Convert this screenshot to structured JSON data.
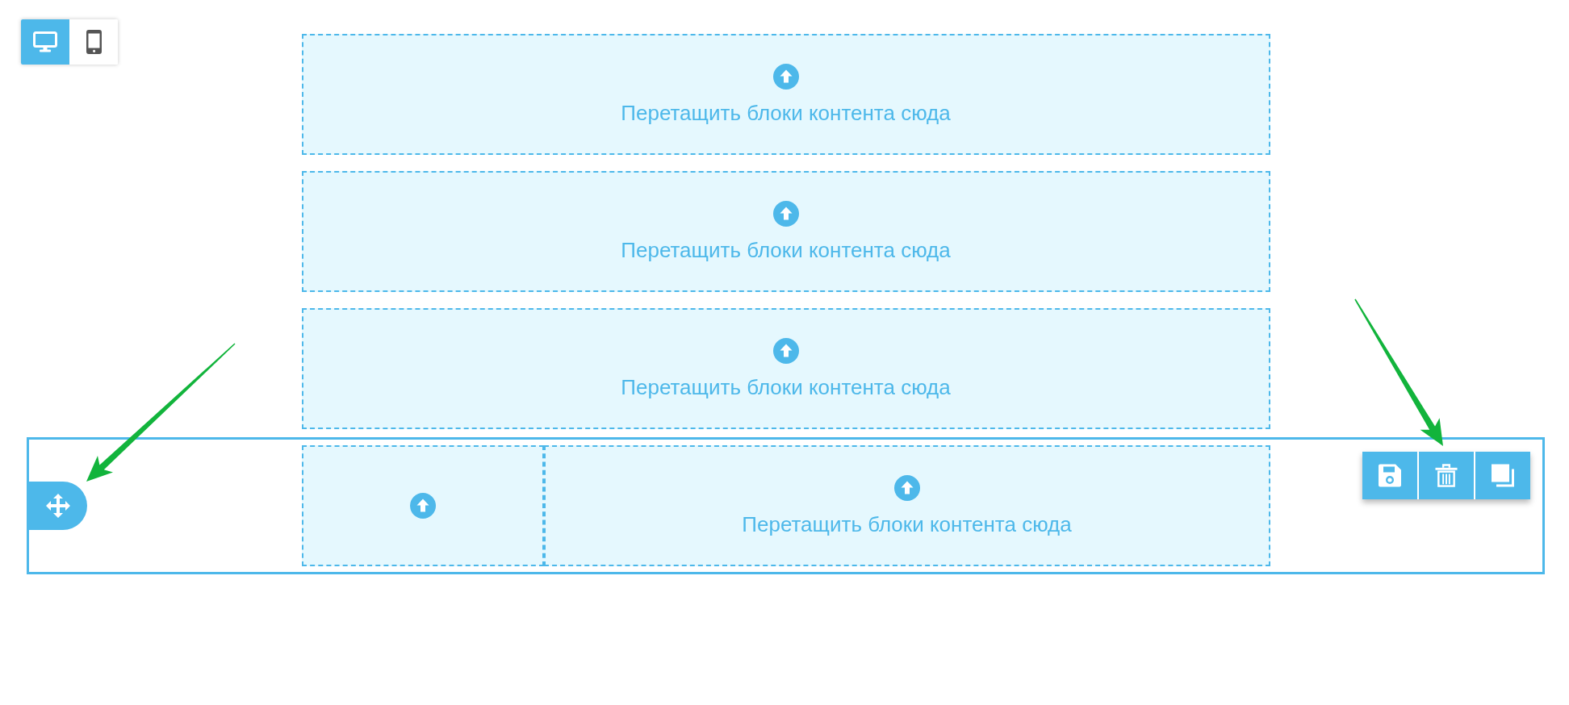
{
  "device_toggle": [
    {
      "kind": "desktop",
      "selected": true
    },
    {
      "kind": "mobile",
      "selected": false
    }
  ],
  "rows": [
    {
      "selected": false,
      "columns": [
        {
          "kind": "labeled",
          "text": "Перетащить блоки контента сюда"
        }
      ]
    },
    {
      "selected": false,
      "columns": [
        {
          "kind": "labeled",
          "text": "Перетащить блоки контента сюда"
        }
      ]
    },
    {
      "selected": false,
      "columns": [
        {
          "kind": "labeled",
          "text": "Перетащить блоки контента сюда"
        }
      ]
    },
    {
      "selected": true,
      "columns": [
        {
          "kind": "icon-only"
        },
        {
          "kind": "labeled",
          "text": "Перетащить блоки контента сюда"
        }
      ]
    }
  ],
  "row_tools": [
    {
      "kind": "save"
    },
    {
      "kind": "delete"
    },
    {
      "kind": "duplicate"
    }
  ]
}
